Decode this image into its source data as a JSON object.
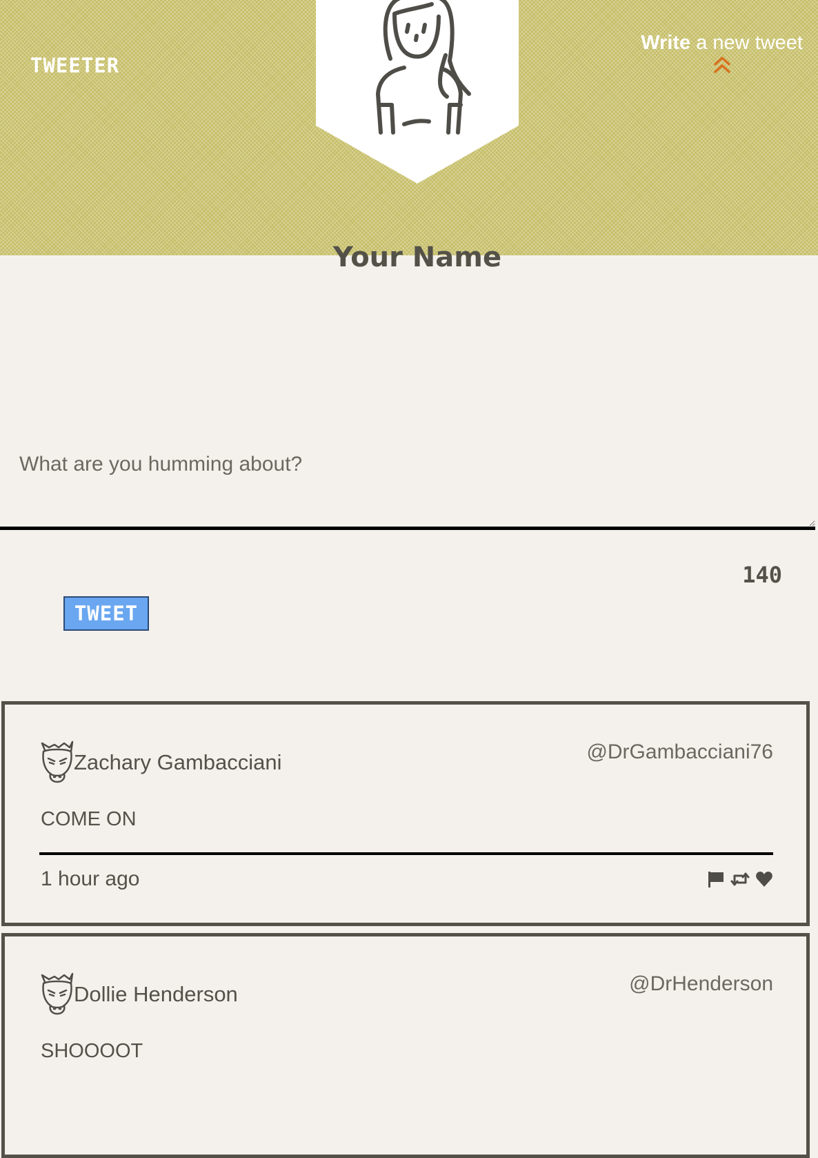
{
  "header": {
    "brand": "TWEETER",
    "compose_link": {
      "word1": "Write",
      "rest": " a new tweet"
    },
    "accent_color": "#d8701e",
    "pattern_color": "#c6be68"
  },
  "profile": {
    "name": "Your Name"
  },
  "compose": {
    "placeholder": "What are you humming about?",
    "counter": "140",
    "tweet_button": "TWEET",
    "button_color": "#6aa7f0"
  },
  "feed": [
    {
      "name": "Zachary Gambacciani",
      "handle": "@DrGambacciani76",
      "text": "COME ON",
      "time": "1 hour ago",
      "actions": [
        "flag-icon",
        "retweet-icon",
        "heart-icon"
      ]
    },
    {
      "name": "Dollie Henderson",
      "handle": "@DrHenderson",
      "text": "SHOOOOT"
    }
  ]
}
